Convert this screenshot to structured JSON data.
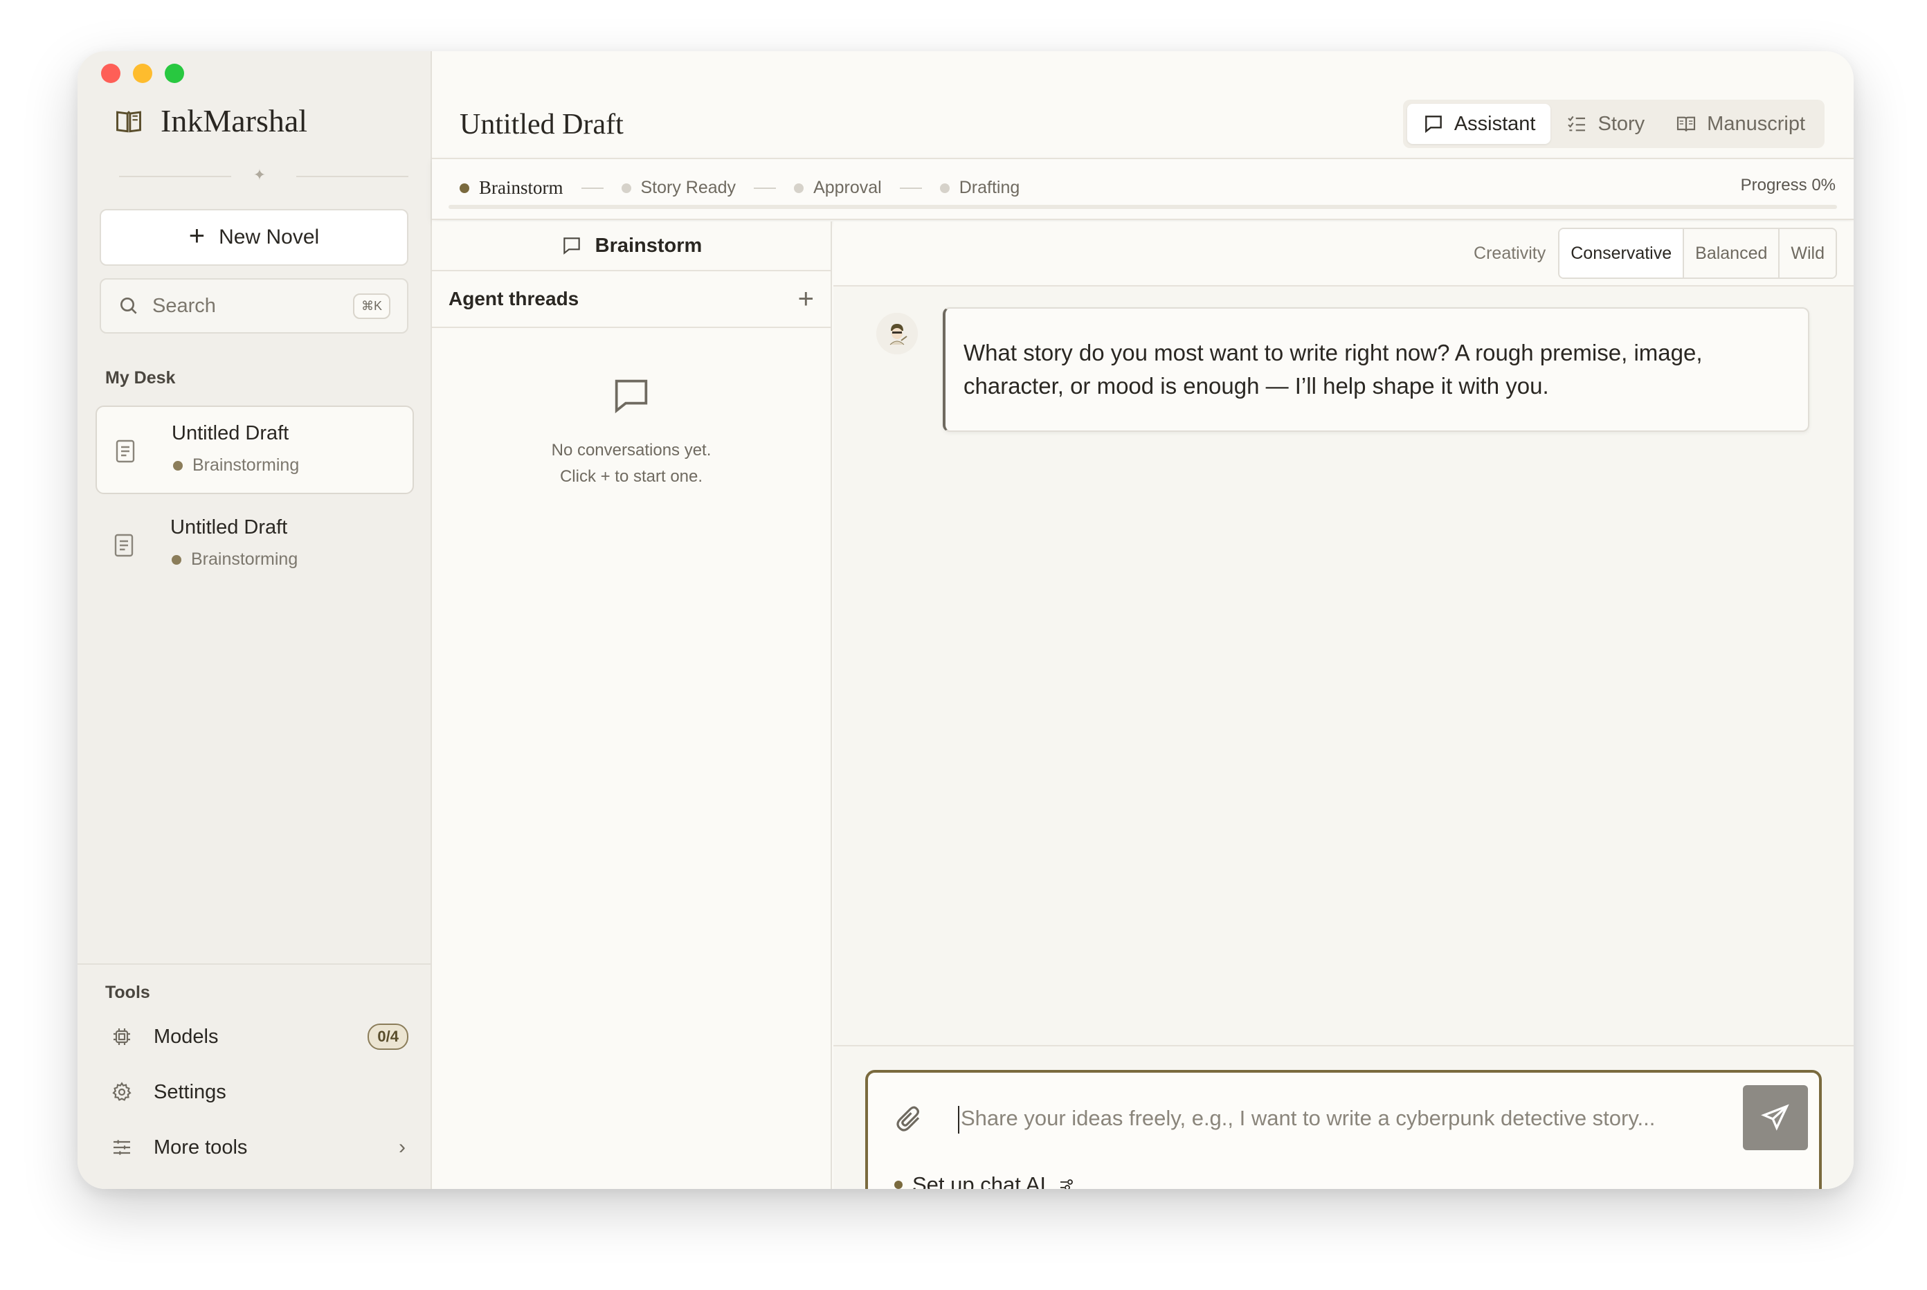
{
  "app": {
    "name": "InkMarshal",
    "colors": {
      "accent": "#7a6a3e",
      "sidebar_bg": "#f1efea",
      "window_bg": "#fbfaf6"
    }
  },
  "sidebar": {
    "new_novel_label": "New Novel",
    "search": {
      "placeholder": "Search",
      "shortcut": "⌘K"
    },
    "my_desk_label": "My Desk",
    "documents": [
      {
        "title": "Untitled Draft",
        "status": "Brainstorming",
        "active": true
      },
      {
        "title": "Untitled Draft",
        "status": "Brainstorming",
        "active": false
      }
    ],
    "tools_label": "Tools",
    "tools": {
      "models": {
        "label": "Models",
        "badge": "0/4",
        "icon": "chip-icon"
      },
      "settings": {
        "label": "Settings",
        "icon": "gear-icon"
      },
      "more": {
        "label": "More tools",
        "icon": "sliders-icon"
      }
    }
  },
  "header": {
    "title": "Untitled Draft",
    "view_tabs": [
      {
        "label": "Assistant",
        "icon": "chat-icon",
        "active": true
      },
      {
        "label": "Story",
        "icon": "checklist-icon",
        "active": false
      },
      {
        "label": "Manuscript",
        "icon": "book-icon",
        "active": false
      }
    ]
  },
  "stages": {
    "items": [
      {
        "label": "Brainstorm",
        "current": true
      },
      {
        "label": "Story Ready",
        "current": false
      },
      {
        "label": "Approval",
        "current": false
      },
      {
        "label": "Drafting",
        "current": false
      }
    ],
    "progress_label": "Progress 0%",
    "progress_fraction": 0
  },
  "threads": {
    "header_label": "Brainstorm",
    "agent_threads_label": "Agent threads",
    "empty_line1": "No conversations yet.",
    "empty_line2": "Click + to start one."
  },
  "chat": {
    "creativity_label": "Creativity",
    "creativity_options": [
      "Conservative",
      "Balanced",
      "Wild"
    ],
    "creativity_selected": "Conservative",
    "message": "What story do you most want to write right now? A rough premise, image, character, or mood is enough — I’ll help shape it with you.",
    "composer": {
      "placeholder": "Share your ideas freely, e.g., I want to write a cyberpunk detective story...",
      "setup_label": "Set up chat AI"
    }
  }
}
